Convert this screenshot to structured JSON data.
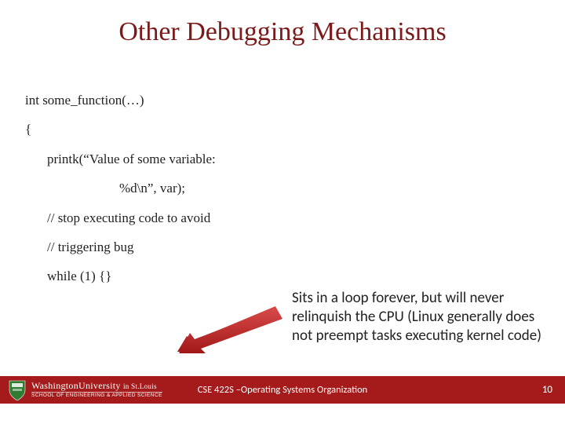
{
  "title": "Other Debugging Mechanisms",
  "code": {
    "l1": "int some_function(…)",
    "l2": "{",
    "l3": "printk(“Value of some variable:",
    "l4": "%d\\n”, var);",
    "l5": "// stop executing code to avoid",
    "l6": "// triggering bug",
    "l7": "while (1) {}"
  },
  "annotation": "Sits in a loop forever, but will never relinquish the CPU (Linux generally does not preempt tasks executing kernel code)",
  "footer": {
    "university_top": "WashingtonUniversity ",
    "university_stl": "in St.Louis",
    "school": "SCHOOL OF ENGINEERING & APPLIED SCIENCE",
    "course": "CSE 422S –Operating Systems Organization",
    "page": "10"
  }
}
